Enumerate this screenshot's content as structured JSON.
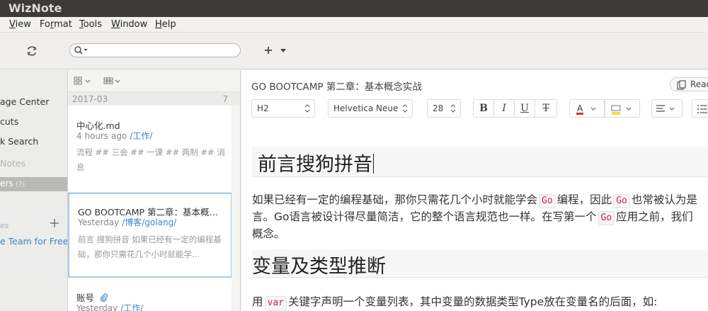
{
  "app": {
    "title": "WizNote"
  },
  "menu": [
    {
      "pre": "",
      "u": "V",
      "post": "iew"
    },
    {
      "pre": "Fo",
      "u": "r",
      "post": "mat"
    },
    {
      "pre": "",
      "u": "T",
      "post": "ools"
    },
    {
      "pre": "",
      "u": "W",
      "post": "indow"
    },
    {
      "pre": "",
      "u": "H",
      "post": "elp"
    }
  ],
  "toolbar": {
    "search_placeholder": "",
    "new_label": "+"
  },
  "sidebar": {
    "items": [
      "age Center",
      "cuts",
      "k Search",
      "Notes",
      "ers",
      "(7)",
      "es",
      "e Team for Free."
    ]
  },
  "notelist": {
    "group": {
      "date": "2017-03",
      "count": "7"
    },
    "notes": [
      {
        "title": "中心化.md",
        "time": "4 hours ago",
        "folder": "/工作/",
        "summary": "流程 ## 三会 ## 一课    ## 两制 ## 消息"
      },
      {
        "title": "GO BOOTCAMP 第二章：基本概念实战",
        "time": "Yesterday",
        "folder": "/博客/golang/",
        "summary": " 前言 搜狗拼音 如果已经有一定的编程基础，那你只需花几个小时就能学..."
      },
      {
        "title": "账号",
        "time": "Yesterday",
        "folder": "/工作/",
        "summary": ""
      }
    ]
  },
  "editor": {
    "doc_title": "GO BOOTCAMP 第二章：基本概念实战",
    "read_label": "Read",
    "style_select": "H2",
    "font_select": "Helvetica Neue",
    "size_select": "28",
    "bold": "B",
    "italic": "I",
    "underline": "U",
    "strike": "T",
    "text_color_letter": "A",
    "heading1": "前言搜狗拼音",
    "p1_a": "如果已经有一定的编程基础，那你只需花几个小时就能学会",
    "code_go": "Go",
    "p1_b": "编程，因此",
    "p1_c": "也常被认为是",
    "p2_a": "言。Go语言被设计得尽量简洁，它的整个语言规范也一样。在写第一个",
    "p2_b": "应用之前，我们",
    "p3": "概念。",
    "heading2": "变量及类型推断",
    "p4_a": "用",
    "code_var": "var",
    "p4_b": "关键字声明一个变量列表，其中变量的数据类型Type放在变量名的后面，如:"
  }
}
